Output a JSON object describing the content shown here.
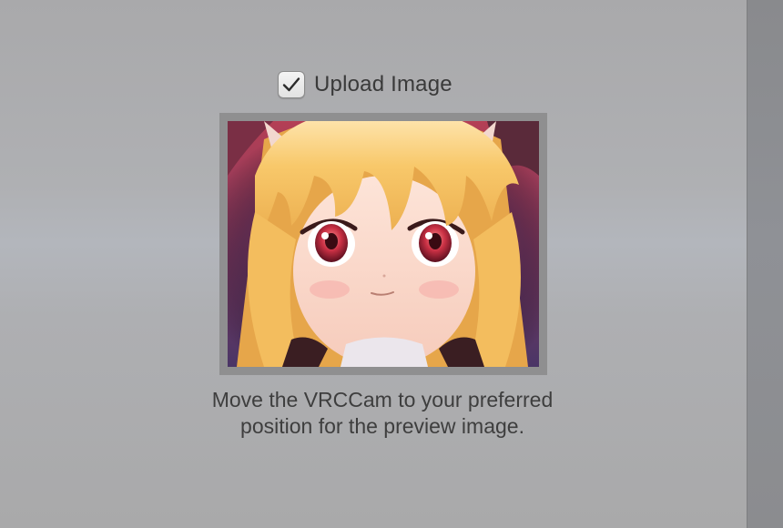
{
  "upload": {
    "label": "Upload Image",
    "checked": true
  },
  "preview": {
    "alt": "avatar preview image"
  },
  "caption": {
    "line1": "Move the VRCCam to your preferred",
    "line2": "position for the preview image."
  },
  "colors": {
    "panel_background": "#ababad",
    "preview_frame": "#8f8f90",
    "scrollbar": "#8b8c8f",
    "text": "#3e3e3e"
  },
  "icons": {
    "checkbox": "checkmark-icon",
    "scrollbar": "vertical-scrollbar"
  }
}
